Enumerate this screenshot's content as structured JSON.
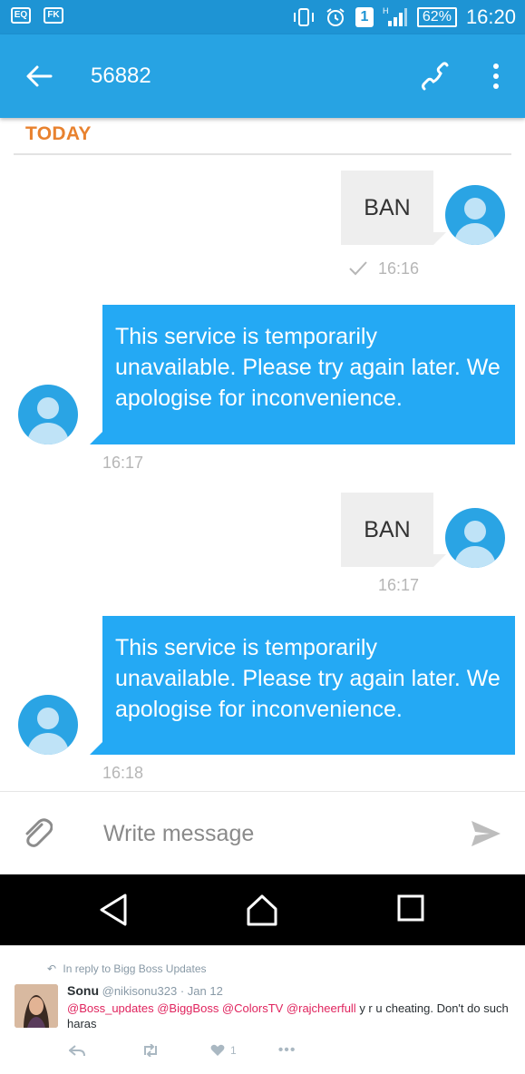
{
  "status_bar": {
    "left_icons": [
      "eq-icon",
      "fk-icon"
    ],
    "badge": "1",
    "battery": "62%",
    "time": "16:20"
  },
  "app_bar": {
    "title": "56882"
  },
  "date_header": "TODAY",
  "messages": [
    {
      "direction": "out",
      "text": "BAN",
      "time": "16:16",
      "delivered": true
    },
    {
      "direction": "in",
      "text": "This service is temporarily unavailable. Please try again later. We apologise for inconvenience.",
      "time": "16:17"
    },
    {
      "direction": "out",
      "text": "BAN",
      "time": "16:17"
    },
    {
      "direction": "in",
      "text": "This service is temporarily unavailable. Please try again later. We apologise for inconvenience.",
      "time": "16:18"
    }
  ],
  "composer": {
    "placeholder": "Write message"
  },
  "tweet": {
    "reply_to": "In reply to Bigg Boss Updates",
    "name": "Sonu",
    "handle_date": "@nikisonu323 · Jan 12",
    "mentions": "@Boss_updates @BiggBoss @ColorsTV @rajcheerfull",
    "text": " y r u cheating. Don't do such haras",
    "likes": "1"
  },
  "colors": {
    "status_bar": "#1e94d4",
    "app_bar": "#27a3e3",
    "incoming_bubble": "#24a9f4",
    "outgoing_bubble": "#eeeeee",
    "date_header": "#e8822f"
  }
}
